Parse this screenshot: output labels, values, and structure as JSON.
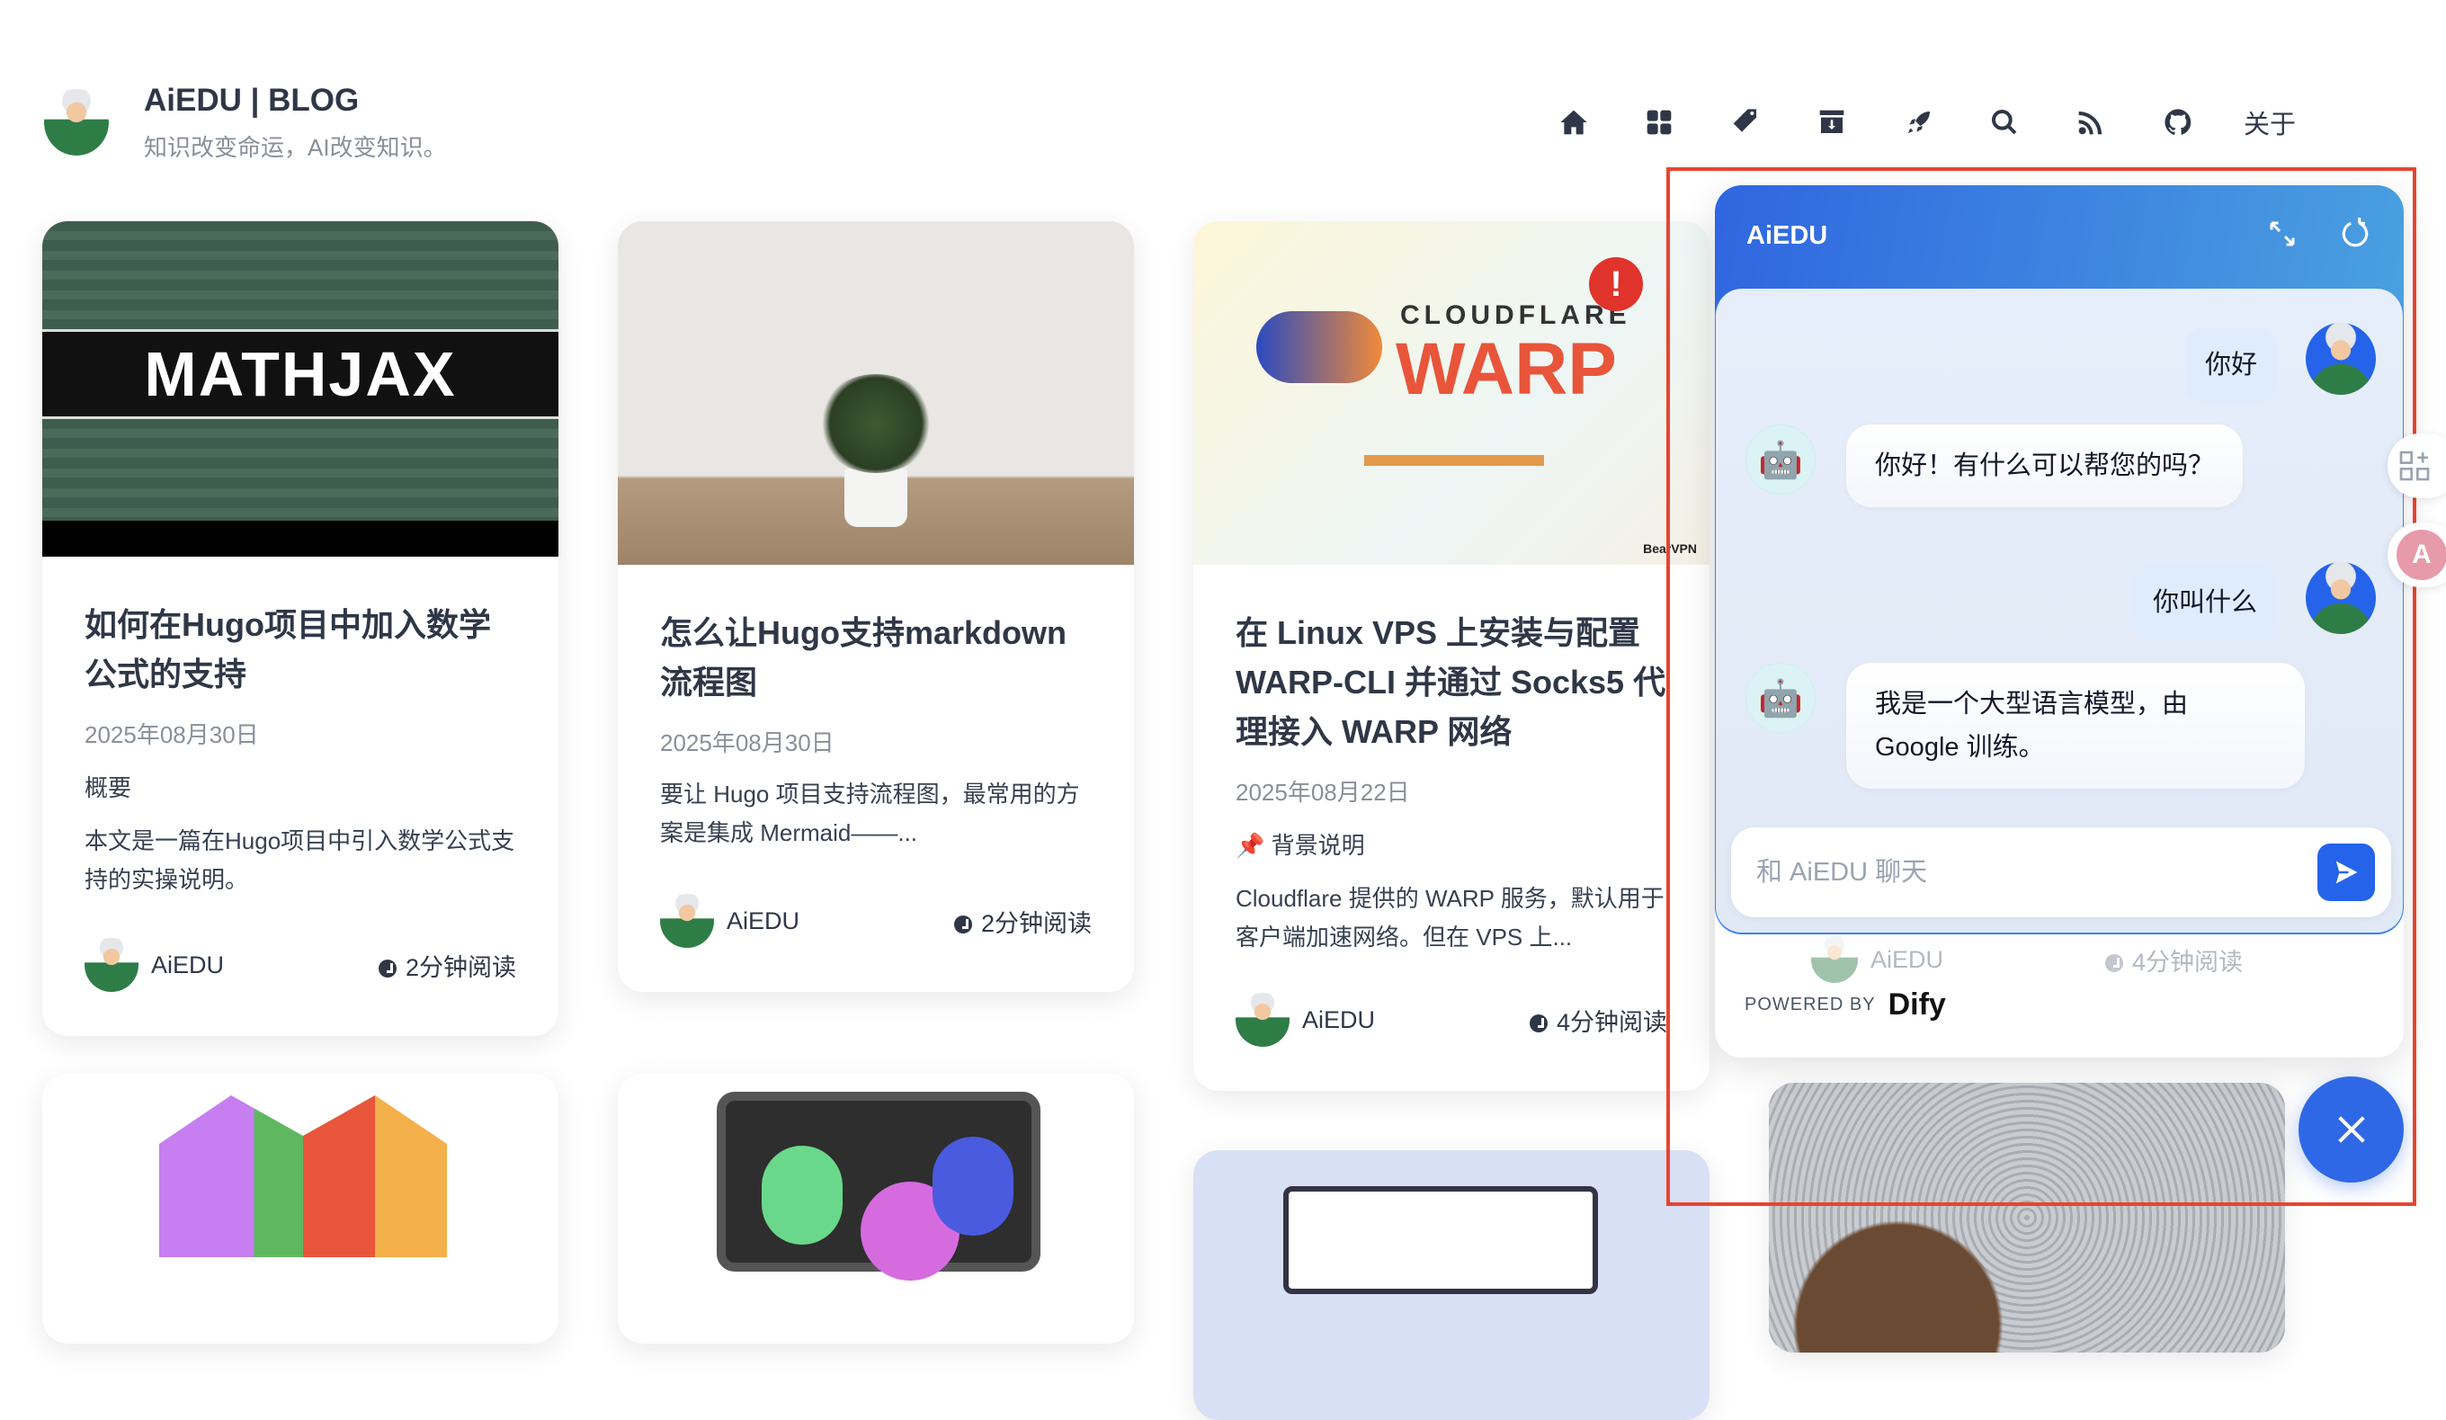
{
  "site": {
    "title": "AiEDU | BLOG",
    "subtitle": "知识改变命运，AI改变知识。"
  },
  "nav": {
    "icons": [
      "home-icon",
      "grid-icon",
      "tags-icon",
      "archive-icon",
      "rocket-icon",
      "search-icon",
      "rss-icon",
      "github-icon"
    ],
    "about_label": "关于"
  },
  "cards": [
    {
      "image_text": "MATHJAX",
      "title": "如何在Hugo项目中加入数学公式的支持",
      "date": "2025年08月30日",
      "section": "概要",
      "summary": "本文是一篇在Hugo项目中引入数学公式支持的实操说明。",
      "author": "AiEDU",
      "read_time": "2分钟阅读"
    },
    {
      "title": "怎么让Hugo支持markdown流程图",
      "date": "2025年08月30日",
      "summary": "要让 Hugo 项目支持流程图，最常用的方案是集成 Mermaid——...",
      "author": "AiEDU",
      "read_time": "2分钟阅读"
    },
    {
      "image_text": "CLOUDFLARE",
      "image_text2": "WARP",
      "image_badge": "BearVPN",
      "title": "在 Linux VPS 上安装与配置 WARP-CLI 并通过 Socks5 代理接入 WARP 网络",
      "date": "2025年08月22日",
      "section": "📌 背景说明",
      "summary": "Cloudflare 提供的 WARP 服务，默认用于客户端加速网络。但在 VPS 上...",
      "author": "AiEDU",
      "read_time": "4分钟阅读"
    },
    {
      "author": "AiEDU",
      "read_time": "4分钟阅读"
    }
  ],
  "chat": {
    "title": "AiEDU",
    "messages": [
      {
        "role": "user",
        "text": "你好"
      },
      {
        "role": "bot",
        "text": "你好！有什么可以帮您的吗？"
      },
      {
        "role": "user",
        "text": "你叫什么"
      },
      {
        "role": "bot",
        "text": "我是一个大型语言模型，由 Google 训练。"
      }
    ],
    "input_placeholder": "和 AiEDU 聊天",
    "powered_by": "POWERED BY",
    "brand": "Dify",
    "accent": "#2563eb"
  },
  "highlight_color": "#e8442e"
}
